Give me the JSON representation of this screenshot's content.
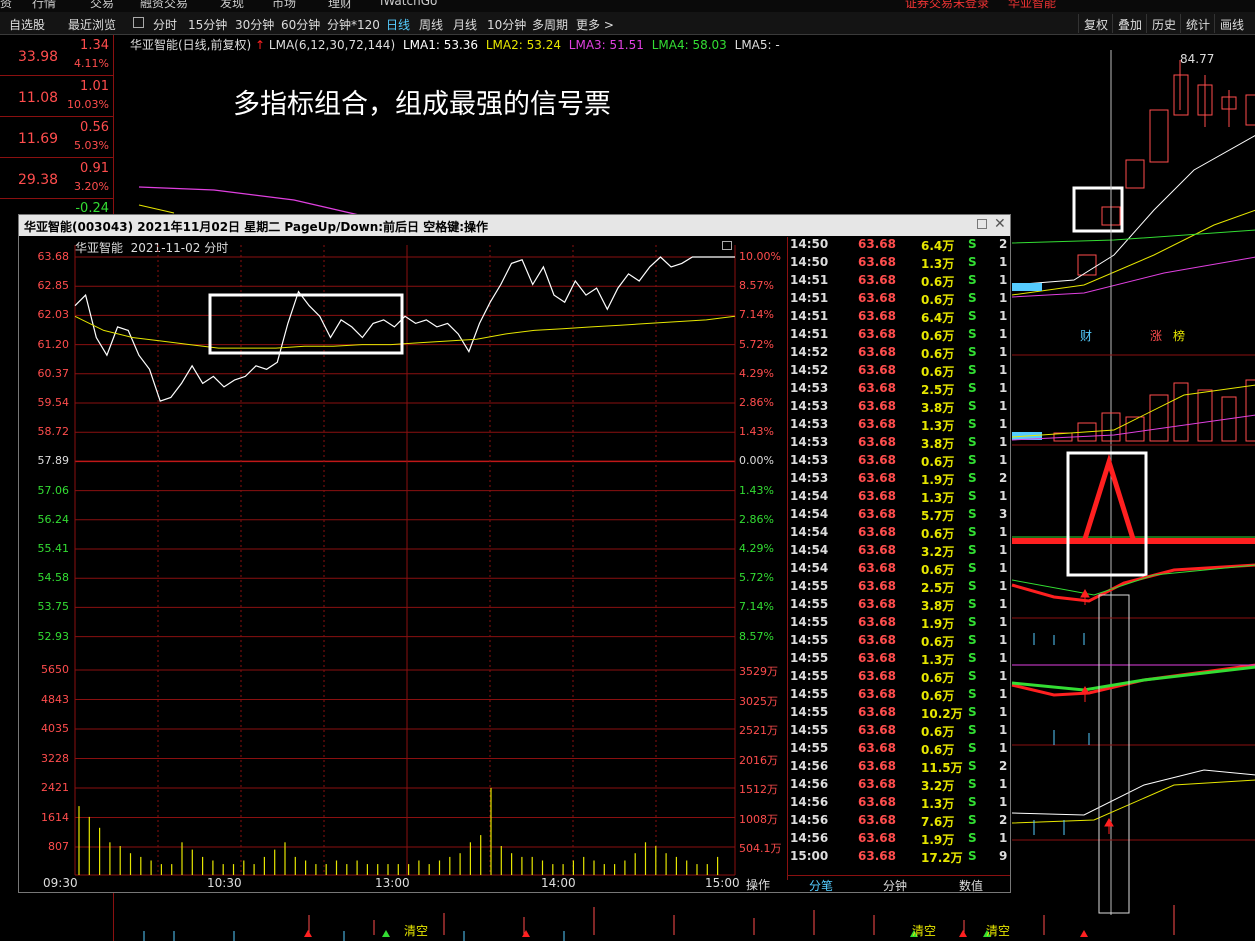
{
  "top_menu": [
    "资",
    "行情",
    "交易",
    "融资交易",
    "发现",
    "市场",
    "理财",
    "iWatchGo",
    "证券交易未登录",
    "华亚智能"
  ],
  "tabs": {
    "left": [
      "自选股",
      "最近浏览"
    ],
    "periods": [
      "分时",
      "15分钟",
      "30分钟",
      "60分钟",
      "分钟*120",
      "日线",
      "周线",
      "月线",
      "10分钟",
      "多周期",
      "更多 >"
    ],
    "active": "日线",
    "right": [
      "复权",
      "叠加",
      "历史",
      "统计",
      "画线"
    ]
  },
  "left_rows": [
    {
      "v1": "33.98",
      "v2": "1.34",
      "v3": "4.11%"
    },
    {
      "v1": "11.08",
      "v2": "1.01",
      "v3": "10.03%"
    },
    {
      "v1": "11.69",
      "v2": "0.56",
      "v3": "5.03%"
    },
    {
      "v1": "29.38",
      "v2": "0.91",
      "v3": "3.20%"
    },
    {
      "v1": "",
      "v2": "-0.24",
      "v3": ""
    }
  ],
  "info_line": {
    "title": "华亚智能(日线,前复权)",
    "lma_label": "LMA(6,12,30,72,144)",
    "lma1": "LMA1: 53.36",
    "lma2": "LMA2: 53.24",
    "lma3": "LMA3: 51.51",
    "lma4": "LMA4: 58.03",
    "lma5": "LMA5: -"
  },
  "headline": "多指标组合，组成最强的信号票",
  "kline_high": "84.77",
  "kline_badges": [
    "财",
    "涨",
    "榜"
  ],
  "bottom_markers": [
    "清空",
    "清空",
    "清空"
  ],
  "popup": {
    "title": "华亚智能(003043) 2021年11月02日 星期二 PageUp/Down:前后日 空格键:操作",
    "subtitle_name": "华亚智能",
    "subtitle_date": "2021-11-02 分时",
    "price_labels": [
      "63.68",
      "62.85",
      "62.03",
      "61.20",
      "60.37",
      "59.54",
      "58.72",
      "57.89",
      "57.06",
      "56.24",
      "55.41",
      "54.58",
      "53.75",
      "52.93"
    ],
    "pct_labels": [
      "10.00%",
      "8.57%",
      "7.14%",
      "5.72%",
      "4.29%",
      "2.86%",
      "1.43%",
      "0.00%",
      "1.43%",
      "2.86%",
      "4.29%",
      "5.72%",
      "7.14%",
      "8.57%"
    ],
    "vol_labels": [
      "5650",
      "4843",
      "4035",
      "3228",
      "2421",
      "1614",
      "807"
    ],
    "vol_right": [
      "3529万",
      "3025万",
      "2521万",
      "2016万",
      "1512万",
      "1008万",
      "504.1万"
    ],
    "time_labels": [
      "09:30",
      "10:30",
      "13:00",
      "14:00",
      "15:00"
    ],
    "op_label": "操作",
    "tick_tabs": [
      "分笔",
      "分钟",
      "数值"
    ],
    "ticks": [
      [
        "14:50",
        "63.68",
        "6.4万",
        "S",
        "2"
      ],
      [
        "14:50",
        "63.68",
        "1.3万",
        "S",
        "1"
      ],
      [
        "14:51",
        "63.68",
        "0.6万",
        "S",
        "1"
      ],
      [
        "14:51",
        "63.68",
        "0.6万",
        "S",
        "1"
      ],
      [
        "14:51",
        "63.68",
        "6.4万",
        "S",
        "1"
      ],
      [
        "14:51",
        "63.68",
        "0.6万",
        "S",
        "1"
      ],
      [
        "14:52",
        "63.68",
        "0.6万",
        "S",
        "1"
      ],
      [
        "14:52",
        "63.68",
        "0.6万",
        "S",
        "1"
      ],
      [
        "14:53",
        "63.68",
        "2.5万",
        "S",
        "1"
      ],
      [
        "14:53",
        "63.68",
        "3.8万",
        "S",
        "1"
      ],
      [
        "14:53",
        "63.68",
        "1.3万",
        "S",
        "1"
      ],
      [
        "14:53",
        "63.68",
        "3.8万",
        "S",
        "1"
      ],
      [
        "14:53",
        "63.68",
        "0.6万",
        "S",
        "1"
      ],
      [
        "14:53",
        "63.68",
        "1.9万",
        "S",
        "2"
      ],
      [
        "14:54",
        "63.68",
        "1.3万",
        "S",
        "1"
      ],
      [
        "14:54",
        "63.68",
        "5.7万",
        "S",
        "3"
      ],
      [
        "14:54",
        "63.68",
        "0.6万",
        "S",
        "1"
      ],
      [
        "14:54",
        "63.68",
        "3.2万",
        "S",
        "1"
      ],
      [
        "14:54",
        "63.68",
        "0.6万",
        "S",
        "1"
      ],
      [
        "14:55",
        "63.68",
        "2.5万",
        "S",
        "1"
      ],
      [
        "14:55",
        "63.68",
        "3.8万",
        "S",
        "1"
      ],
      [
        "14:55",
        "63.68",
        "1.9万",
        "S",
        "1"
      ],
      [
        "14:55",
        "63.68",
        "0.6万",
        "S",
        "1"
      ],
      [
        "14:55",
        "63.68",
        "1.3万",
        "S",
        "1"
      ],
      [
        "14:55",
        "63.68",
        "0.6万",
        "S",
        "1"
      ],
      [
        "14:55",
        "63.68",
        "0.6万",
        "S",
        "1"
      ],
      [
        "14:55",
        "63.68",
        "10.2万",
        "S",
        "1"
      ],
      [
        "14:55",
        "63.68",
        "0.6万",
        "S",
        "1"
      ],
      [
        "14:55",
        "63.68",
        "0.6万",
        "S",
        "1"
      ],
      [
        "14:56",
        "63.68",
        "11.5万",
        "S",
        "2"
      ],
      [
        "14:56",
        "63.68",
        "3.2万",
        "S",
        "1"
      ],
      [
        "14:56",
        "63.68",
        "1.3万",
        "S",
        "1"
      ],
      [
        "14:56",
        "63.68",
        "7.6万",
        "S",
        "2"
      ],
      [
        "14:56",
        "63.68",
        "1.9万",
        "S",
        "1"
      ],
      [
        "15:00",
        "63.68",
        "17.2万",
        "S",
        "9"
      ]
    ]
  },
  "colors": {
    "up": "#ff4d4d",
    "down": "#33dd33",
    "grid": "#8a1010",
    "ma_yellow": "#e6e600",
    "ma_magenta": "#e040e0",
    "accent": "#55ccff"
  }
}
